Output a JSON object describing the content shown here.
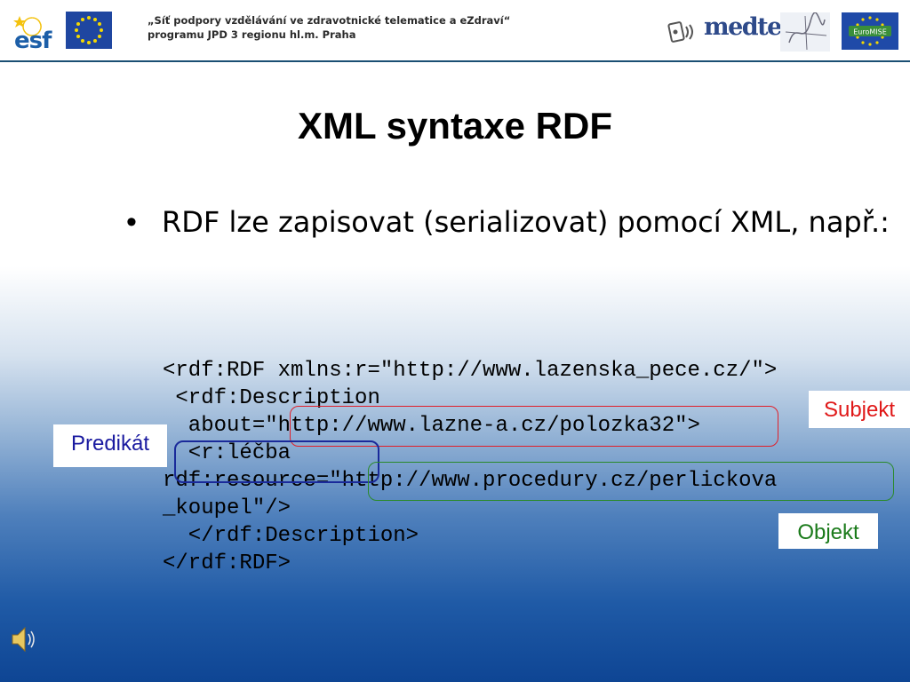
{
  "header": {
    "program_line1": "„Síť podpory vzdělávání ve zdravotnické telematice a eZdraví“",
    "program_line2": "programu JPD 3 regionu hl.m. Praha",
    "esf_logo_text": "esf",
    "medtel_logo_text": "medtel",
    "euromise_logo_text": "EuroMISE",
    "icons": [
      "esf-logo",
      "eu-flag-icon",
      "medtel-logo",
      "sis-logo",
      "euromise-logo"
    ]
  },
  "slide": {
    "title": "XML syntaxe RDF",
    "bullet_symbol": "•",
    "bullet_text": "RDF lze zapisovat (serializovat) pomocí XML, např.:",
    "code_lines": [
      "<rdf:RDF xmlns:r=\"http://www.lazenska_pece.cz/\">",
      " <rdf:Description",
      "  about=\"http://www.lazne-a.cz/polozka32\">",
      "  <r:léčba",
      "rdf:resource=\"http://www.procedury.cz/perlickova",
      "_koupel\"/>",
      "  </rdf:Description>",
      "</rdf:RDF>"
    ],
    "labels": {
      "subjekt": "Subjekt",
      "predikat": "Predikát",
      "objekt": "Objekt"
    }
  },
  "colors": {
    "subjekt": "#e01818",
    "predikat": "#1a1aa0",
    "objekt": "#1a7a1a",
    "background_bottom": "#0e4594"
  },
  "footer": {
    "icon": "speaker-icon"
  }
}
